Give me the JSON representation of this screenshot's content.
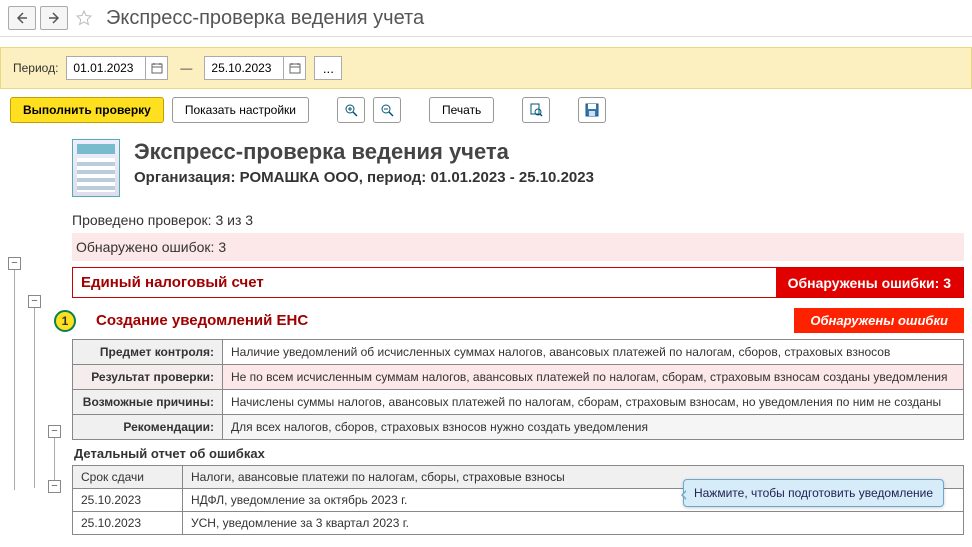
{
  "title": "Экспресс-проверка ведения учета",
  "period": {
    "label": "Период:",
    "from": "01.01.2023",
    "to": "25.10.2023",
    "dash": "—"
  },
  "toolbar": {
    "run": "Выполнить проверку",
    "settings": "Показать настройки",
    "print": "Печать",
    "dots": "..."
  },
  "report": {
    "title": "Экспресс-проверка ведения учета",
    "subtitle": "Организация: РОМАШКА ООО, период: 01.01.2023 - 25.10.2023",
    "checks_done": "Проведено проверок: 3 из 3",
    "errors_found": "Обнаружено ошибок: 3"
  },
  "section": {
    "title": "Единый налоговый счет",
    "status": "Обнаружены ошибки: 3"
  },
  "step": {
    "num": "1",
    "title": "Создание уведомлений ЕНС",
    "status": "Обнаружены ошибки",
    "rows": [
      {
        "k": "Предмет контроля:",
        "v": "Наличие уведомлений об исчисленных суммах налогов, авансовых платежей по налогам, сборов, страховых взносов"
      },
      {
        "k": "Результат проверки:",
        "v": "Не по всем исчисленным суммам налогов, авансовых платежей по налогам, сборам, страховым взносам созданы уведомления"
      },
      {
        "k": "Возможные причины:",
        "v": "Начислены суммы налогов, авансовых платежей по налогам, сборам, страховым взносам, но уведомления по ним не созданы"
      },
      {
        "k": "Рекомендации:",
        "v": "Для всех налогов, сборов, страховых взносов нужно создать уведомления"
      }
    ]
  },
  "details": {
    "title": "Детальный отчет об ошибках",
    "head": {
      "c1": "Срок сдачи",
      "c2": "Налоги, авансовые платежи по налогам, сборы, страховые взносы"
    },
    "rows": [
      {
        "c1": "25.10.2023",
        "c2": "НДФЛ, уведомление за октябрь 2023 г."
      },
      {
        "c1": "25.10.2023",
        "c2": "УСН, уведомление за 3 квартал 2023 г."
      }
    ],
    "tooltip": "Нажмите, чтобы подготовить уведомление"
  }
}
